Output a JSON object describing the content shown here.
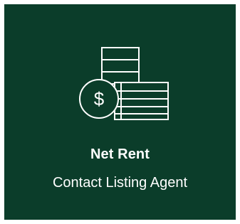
{
  "card": {
    "title": "Net Rent",
    "subtitle": "Contact Listing Agent",
    "icon": "money-stack-icon",
    "background_color": "#0b3d2a",
    "text_color": "#ffffff"
  }
}
